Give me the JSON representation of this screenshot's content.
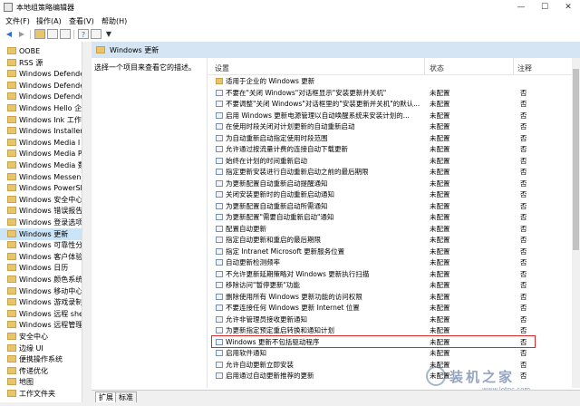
{
  "window": {
    "title": "本地组策略编辑器",
    "min": "—",
    "max": "☐",
    "close": "✕"
  },
  "menu": [
    "文件(F)",
    "操作(A)",
    "查看(V)",
    "帮助(H)"
  ],
  "toolbar": {
    "back": "◀",
    "forward": "▶",
    "filter": "▼",
    "help": "?"
  },
  "tree": [
    "OOBE",
    "RSS 源",
    "Windows Defende",
    "Windows Defende",
    "Windows Defende",
    "Windows Hello 企",
    "Windows Ink 工作",
    "Windows Installer",
    "Windows Media I",
    "Windows Media P",
    "Windows Media 数",
    "Windows Messen",
    "Windows PowerSh",
    "Windows 安全中心",
    "Windows 错误报告",
    "Windows 登录选项",
    "Windows 更新",
    "Windows 可靠性分",
    "Windows 客户体验",
    "Windows 日历",
    "Windows 颜色系统",
    "Windows 移动中心",
    "Windows 游戏录制",
    "Windows 远程 she",
    "Windows 远程管理",
    "安全中心",
    "边缘 UI",
    "便携操作系统",
    "传递优化",
    "地图",
    "工作文件夹"
  ],
  "tree_selected": 16,
  "header": {
    "title": "Windows 更新"
  },
  "description": "选择一个项目来查看它的描述。",
  "columns": {
    "setting": "设置",
    "status": "状态",
    "note": "注释"
  },
  "rows": [
    {
      "name": "适用于企业的 Windows 更新",
      "status": "",
      "note": "",
      "folder": true
    },
    {
      "name": "不要在\"关闭 Windows\"对话框显示\"安装更新并关机\"",
      "status": "未配置",
      "note": "否"
    },
    {
      "name": "不要调整\"关闭 Windows\"对话框里的\"安装更新并关机\"的默认...",
      "status": "未配置",
      "note": "否"
    },
    {
      "name": "启用 Windows 更新电源管理以自动唤醒系统来安装计划的...",
      "status": "未配置",
      "note": "否"
    },
    {
      "name": "在使用时段关闭对计划更新的自动重新启动",
      "status": "未配置",
      "note": "否"
    },
    {
      "name": "为自动重新启动指定使用时段范围",
      "status": "未配置",
      "note": "否"
    },
    {
      "name": "允许通过按流量计费的连接自动下载更新",
      "status": "未配置",
      "note": "否"
    },
    {
      "name": "始终在计划的时间重新启动",
      "status": "未配置",
      "note": "否"
    },
    {
      "name": "指定更新安装进行自动重新启动之前的最后期限",
      "status": "未配置",
      "note": "否"
    },
    {
      "name": "为更新配置自动重新启动提醒通知",
      "status": "未配置",
      "note": "否"
    },
    {
      "name": "关闭安装更新时的自动重新启动通知",
      "status": "未配置",
      "note": "否"
    },
    {
      "name": "为更新配置自动重新启动所需通知",
      "status": "未配置",
      "note": "否"
    },
    {
      "name": "为更新配置\"需要自动重新启动\"通知",
      "status": "未配置",
      "note": "否"
    },
    {
      "name": "配置自动更新",
      "status": "未配置",
      "note": "否"
    },
    {
      "name": "指定自动更新和重启的最后期限",
      "status": "未配置",
      "note": "否"
    },
    {
      "name": "指定 Intranet Microsoft 更新服务位置",
      "status": "未配置",
      "note": "否"
    },
    {
      "name": "自动更新检测频率",
      "status": "未配置",
      "note": "否"
    },
    {
      "name": "不允许更新延期策略对 Windows 更新执行扫描",
      "status": "未配置",
      "note": "否"
    },
    {
      "name": "移除访问\"暂停更新\"功能",
      "status": "未配置",
      "note": "否"
    },
    {
      "name": "删除使用所有 Windows 更新功能的访问权限",
      "status": "未配置",
      "note": "否"
    },
    {
      "name": "不要连接任何 Windows 更新 Internet 位置",
      "status": "未配置",
      "note": "否"
    },
    {
      "name": "允许非管理员接收更新通知",
      "status": "未配置",
      "note": "否"
    },
    {
      "name": "为更新指定预定重启转换和通知计划",
      "status": "未配置",
      "note": "否"
    },
    {
      "name": "Windows 更新不包括驱动程序",
      "status": "未配置",
      "note": "否"
    },
    {
      "name": "启用软件通知",
      "status": "未配置",
      "note": "否"
    },
    {
      "name": "允许自动更新立即安装",
      "status": "未配置",
      "note": "否"
    },
    {
      "name": "启用通过自动更新推荐的更新",
      "status": "未配置",
      "note": "否"
    }
  ],
  "highlighted_row": 23,
  "tabs": [
    "扩展",
    "标准"
  ],
  "watermark": {
    "text": "装机之家",
    "url": "www.lotpc.com"
  }
}
